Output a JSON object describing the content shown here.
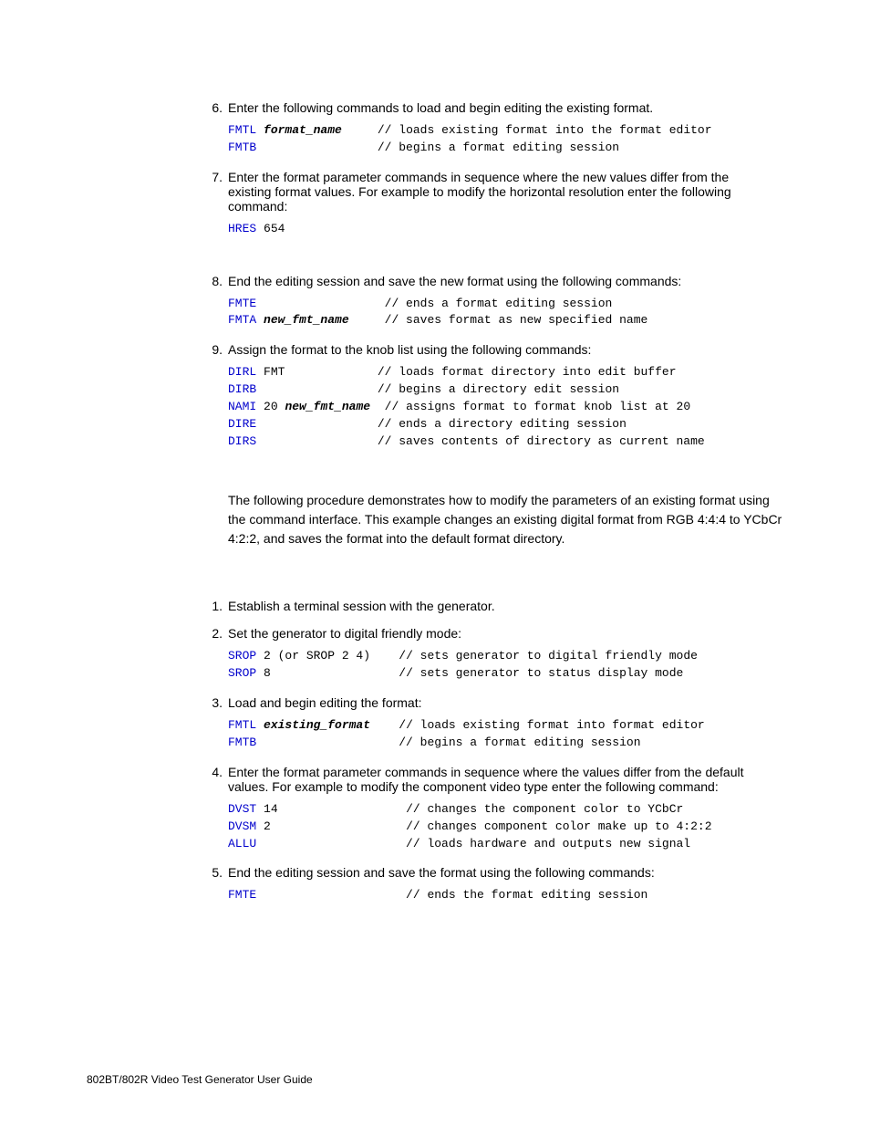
{
  "steps_a": [
    {
      "n": "6.",
      "text": "Enter the following commands to load and begin editing the existing format."
    },
    {
      "n": "7.",
      "text": "Enter the format parameter commands in sequence where the new values differ from the existing format values. For example to modify the horizontal resolution enter the following command:"
    },
    {
      "n": "8.",
      "text": "End the editing session and save the new format using the following commands:"
    },
    {
      "n": "9.",
      "text": "Assign the format to the knob list using the following commands:"
    }
  ],
  "code6": {
    "l1c": "FMTL ",
    "l1i": "format_name",
    "l1p": "     ",
    "l1r": "// loads existing format into the format editor",
    "l2c": "FMTB",
    "l2p": "                 ",
    "l2r": "// begins a format editing session"
  },
  "code7": {
    "c": "HRES",
    "r": " 654"
  },
  "code8": {
    "l1c": "FMTE",
    "l1p": "                  ",
    "l1r": "// ends a format editing session",
    "l2c": "FMTA ",
    "l2i": "new_fmt_name",
    "l2p": "     ",
    "l2r": "// saves format as new specified name"
  },
  "code9": {
    "l1c": "DIRL",
    "l1m": " FMT",
    "l1p": "             ",
    "l1r": "// loads format directory into edit buffer",
    "l2c": "DIRB",
    "l2p": "                 ",
    "l2r": "// begins a directory edit session",
    "l3c": "NAMI",
    "l3m": " 20 ",
    "l3i": "new_fmt_name",
    "l3p": "  ",
    "l3r": "// assigns format to format knob list at 20",
    "l4c": "DIRE",
    "l4p": "                 ",
    "l4r": "// ends a directory editing session",
    "l5c": "DIRS",
    "l5p": "                 ",
    "l5r": "// saves contents of directory as current name"
  },
  "middle_para": "The following procedure demonstrates how to modify the parameters of an existing format using the command interface. This example changes an existing digital format from RGB 4:4:4 to YCbCr 4:2:2, and saves the format into the default format directory.",
  "steps_b": [
    {
      "n": "1.",
      "text": "Establish a terminal session with the generator."
    },
    {
      "n": "2.",
      "text": "Set the generator to digital friendly mode:"
    },
    {
      "n": "3.",
      "text": "Load and begin editing the format:"
    },
    {
      "n": "4.",
      "text": "Enter the format parameter commands in sequence where the values differ from the default values. For example to modify the component video type enter the following command:"
    },
    {
      "n": "5.",
      "text": "End the editing session and save the format using the following commands:"
    }
  ],
  "codeB2": {
    "l1c": "SROP",
    "l1m": " 2 (or SROP 2 4)",
    "l1p": "    ",
    "l1r": "// sets generator to digital friendly mode",
    "l2c": "SROP",
    "l2m": " 8",
    "l2p": "                  ",
    "l2r": "// sets generator to status display mode"
  },
  "codeB3": {
    "l1c": "FMTL ",
    "l1i": "existing_format",
    "l1p": "    ",
    "l1r": "// loads existing format into format editor",
    "l2c": "FMTB",
    "l2p": "                    ",
    "l2r": "// begins a format editing session"
  },
  "codeB4": {
    "l1c": "DVST",
    "l1m": " 14",
    "l1p": "                  ",
    "l1r": "// changes the component color to YCbCr",
    "l2c": "DVSM",
    "l2m": " 2",
    "l2p": "                   ",
    "l2r": "// changes component color make up to 4:2:2",
    "l3c": "ALLU",
    "l3p": "                     ",
    "l3r": "// loads hardware and outputs new signal"
  },
  "codeB5": {
    "l1c": "FMTE",
    "l1p": "                     ",
    "l1r": "// ends the format editing session"
  },
  "footer": "802BT/802R Video Test Generator User Guide"
}
